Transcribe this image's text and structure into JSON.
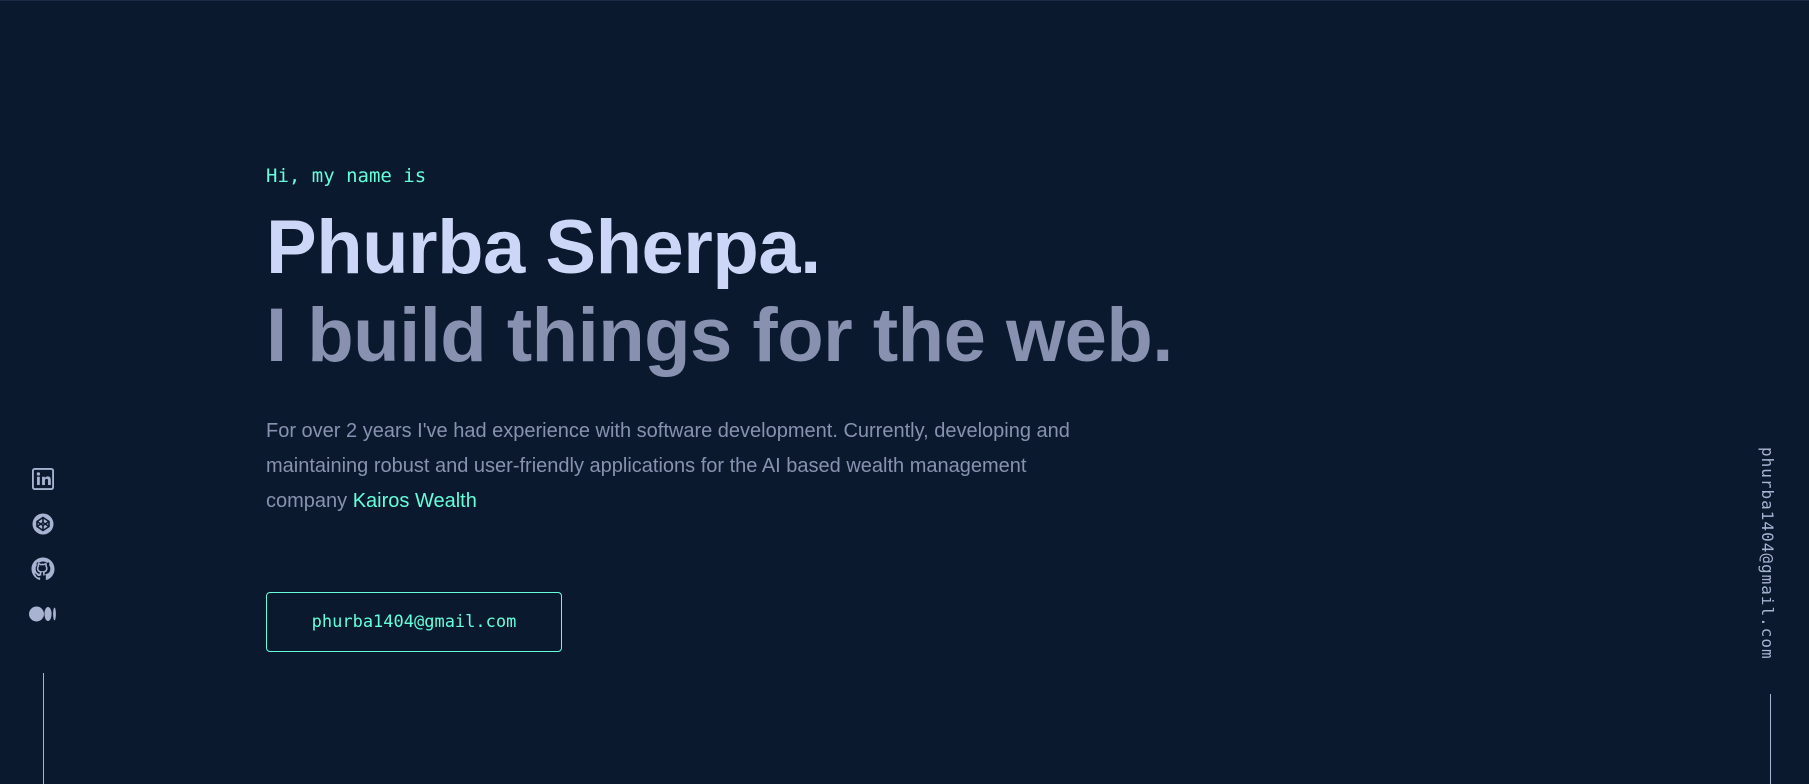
{
  "hero": {
    "greeting": "Hi, my name is",
    "name": "Phurba Sherpa.",
    "tagline": "I build things for the web.",
    "intro_text": "For over 2 years I've had experience with software development. Currently, developing and maintaining robust and user-friendly applications for the AI based wealth management company ",
    "company_link": "Kairos Wealth",
    "cta_label": "phurba1404@gmail.com"
  },
  "social": {
    "items": [
      {
        "name": "LinkedIn",
        "icon": "linkedin-icon"
      },
      {
        "name": "CodePen",
        "icon": "codepen-icon"
      },
      {
        "name": "GitHub",
        "icon": "github-icon"
      },
      {
        "name": "Medium",
        "icon": "medium-icon"
      }
    ]
  },
  "side_email": "phurba1404@gmail.com",
  "colors": {
    "background": "#0b192f",
    "accent": "#64ffda",
    "heading": "#ccd6f6",
    "muted": "#8892b0",
    "light_slate": "#a8b2d1"
  }
}
